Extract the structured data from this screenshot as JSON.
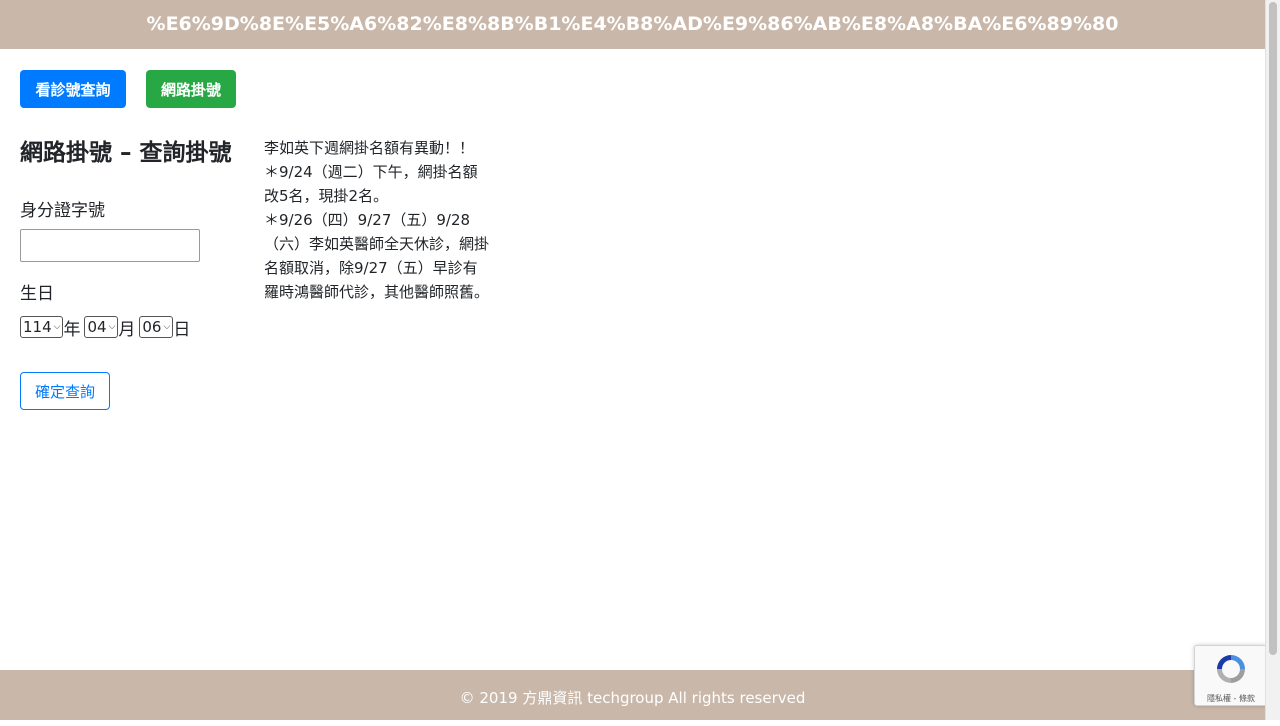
{
  "header": {
    "title": "%E6%9D%8E%E5%A6%82%E8%8B%B1%E4%B8%AD%E9%86%AB%E8%A8%BA%E6%89%80",
    "bg_color": "#c9b7a9"
  },
  "nav": {
    "lookup_label": "看診號查詢",
    "register_label": "網路掛號"
  },
  "form": {
    "title": "網路掛號 – 查詢掛號",
    "id_label": "身分證字號",
    "id_value": "",
    "birthday_label": "生日",
    "year_value": "114",
    "year_unit": "年",
    "month_value": "04",
    "month_unit": "月",
    "day_value": "06",
    "day_unit": "日",
    "submit_label": "確定查詢"
  },
  "notice": {
    "text": "李如英下週網掛名額有異動！！\n＊9/24（週二）下午，網掛名額\n改5名，現掛2名。\n＊9/26（四）9/27（五）9/28\n（六）李如英醫師全天休診，網掛\n名額取消，除9/27（五）早診有\n羅時鴻醫師代診，其他醫師照舊。"
  },
  "footer": {
    "text": "© 2019 方鼎資訊 techgroup All rights reserved"
  },
  "recaptcha": {
    "terms": "隱私權 - 條款",
    "icon": "recaptcha-icon"
  },
  "colors": {
    "primary": "#007bff",
    "success": "#28a745",
    "brand": "#c9b7a9"
  }
}
